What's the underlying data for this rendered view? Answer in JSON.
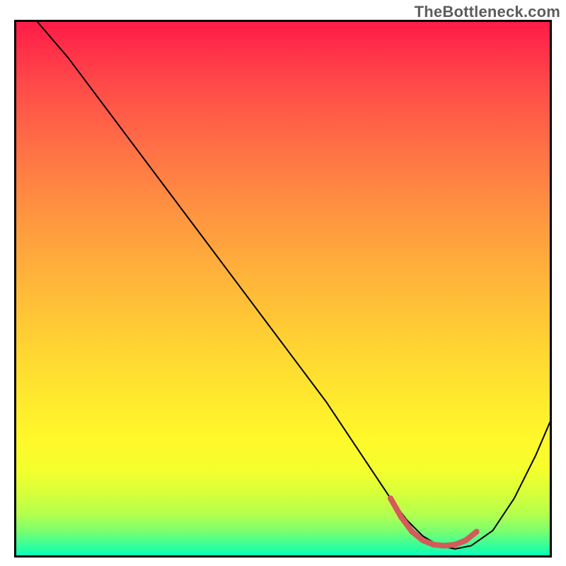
{
  "watermark": "TheBottleneck.com",
  "chart_data": {
    "type": "line",
    "title": "",
    "xlabel": "",
    "ylabel": "",
    "xlim": [
      0,
      100
    ],
    "ylim": [
      0,
      100
    ],
    "series": [
      {
        "name": "bottleneck-curve",
        "color": "#000000",
        "stroke_width": 2,
        "x": [
          4,
          10,
          16,
          22,
          28,
          34,
          40,
          46,
          52,
          58,
          62,
          66,
          70,
          73,
          76,
          79,
          82,
          85,
          89,
          93,
          97,
          100
        ],
        "y": [
          100,
          93,
          85,
          77,
          69,
          61,
          53,
          45,
          37,
          29,
          23,
          17,
          11,
          7,
          4,
          2.2,
          1.6,
          2.2,
          5,
          11,
          19,
          26
        ]
      },
      {
        "name": "optimal-range",
        "color": "#d55a5a",
        "stroke_width": 8,
        "x": [
          70,
          72,
          74,
          76,
          78,
          80,
          82,
          84,
          86
        ],
        "y": [
          11,
          7.5,
          4.8,
          3.2,
          2.4,
          2.2,
          2.4,
          3.2,
          4.8
        ]
      }
    ],
    "optimal_range_markers": {
      "x": [
        70,
        72,
        74,
        76,
        78,
        80,
        82,
        84,
        86
      ],
      "y": [
        11,
        7.5,
        4.8,
        3.2,
        2.4,
        2.2,
        2.4,
        3.2,
        4.8
      ],
      "color": "#d55a5a",
      "radius": 4
    },
    "background": {
      "type": "vertical-gradient",
      "stops": [
        {
          "pos": 0,
          "color": "#ff1a47"
        },
        {
          "pos": 50,
          "color": "#ffc236"
        },
        {
          "pos": 80,
          "color": "#fff82a"
        },
        {
          "pos": 100,
          "color": "#00ffc0"
        }
      ]
    }
  }
}
